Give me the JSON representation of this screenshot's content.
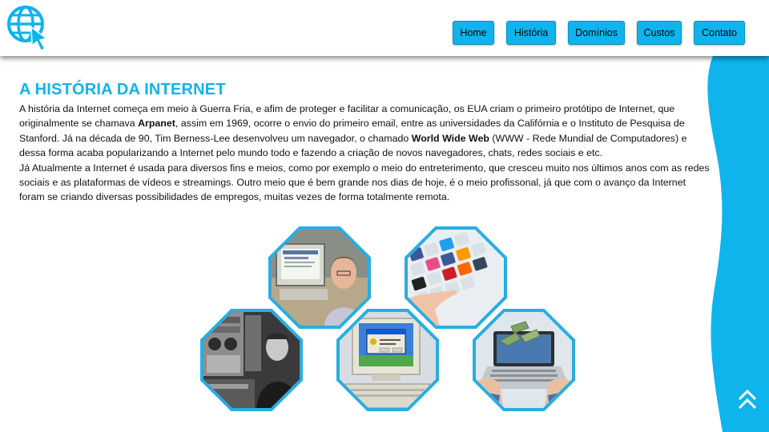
{
  "nav": {
    "items": [
      {
        "label": "Home"
      },
      {
        "label": "História"
      },
      {
        "label": "Domínios"
      },
      {
        "label": "Custos"
      },
      {
        "label": "Contato"
      }
    ]
  },
  "main": {
    "title": "A HISTÓRIA DA INTERNET",
    "p1": {
      "t1": "A história da Internet começa em meio à Guerra Fria, e afim de proteger e facilitar a comunicação, os EUA criam o primeiro protótipo de Internet, que originalmente se chamava ",
      "b1": "Arpanet",
      "t2": ", assim em 1969, ocorre o envio do primeiro email, entre as universidades da Califórnia e o Instituto de Pesquisa de Stanford. Já na década de 90, Tim Berness-Lee desenvolveu um navegador, o chamado ",
      "b2": "World Wide Web",
      "t3": " (WWW - Rede Mundial de Computadores) e dessa forma acaba popularizando a Internet pelo mundo todo e fazendo a criação de novos navegadores, chats, redes sociais e etc."
    },
    "p2": "Já Atualmente a Internet é usada para diversos fins e meios, como por exemplo o meio do entreterimento, que cresceu muito nos últimos anos com as redes sociais e as plataformas de vídeos e streamings. Outro meio que é bem grande nos dias de hoje, é o meio profissonal, já que com o avanço da Internet foram se criando diversas possibilidades de empregos, muitas vezes de forma totalmente remota."
  },
  "colors": {
    "accent": "#0fb4ec",
    "frame": "#27aee3"
  },
  "icons": {
    "logo": "globe-cursor-icon",
    "scroll_top": "double-chevron-up-icon"
  }
}
